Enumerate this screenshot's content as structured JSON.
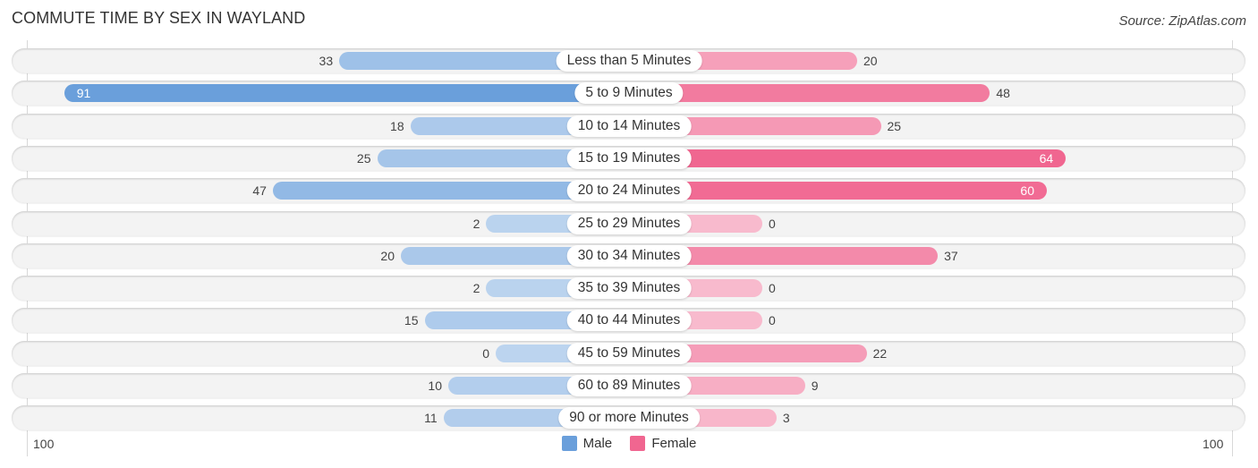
{
  "chart_data": {
    "type": "bar",
    "orientation": "horizontal-diverging",
    "title": "COMMUTE TIME BY SEX IN WAYLAND",
    "source": "Source: ZipAtlas.com",
    "categories": [
      "Less than 5 Minutes",
      "5 to 9 Minutes",
      "10 to 14 Minutes",
      "15 to 19 Minutes",
      "20 to 24 Minutes",
      "25 to 29 Minutes",
      "30 to 34 Minutes",
      "35 to 39 Minutes",
      "40 to 44 Minutes",
      "45 to 59 Minutes",
      "60 to 89 Minutes",
      "90 or more Minutes"
    ],
    "series": [
      {
        "name": "Male",
        "color": "#6a9fdb",
        "values": [
          33,
          91,
          18,
          25,
          47,
          2,
          20,
          2,
          15,
          0,
          10,
          11
        ]
      },
      {
        "name": "Female",
        "color": "#f06690",
        "values": [
          20,
          48,
          25,
          64,
          60,
          0,
          37,
          0,
          0,
          22,
          9,
          3
        ]
      }
    ],
    "axis": {
      "left_label": "100",
      "right_label": "100",
      "xlim": [
        -100,
        100
      ]
    },
    "legend": {
      "placement": "bottom-center",
      "items": [
        "Male",
        "Female"
      ]
    },
    "grid": false
  }
}
